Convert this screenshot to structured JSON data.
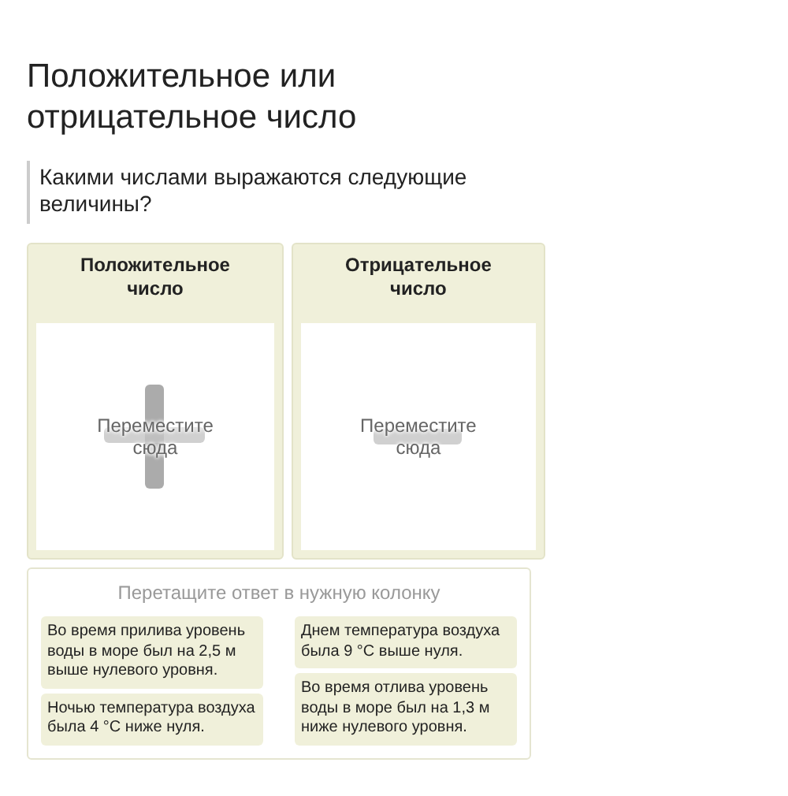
{
  "title": "Положительное или отрицательное число",
  "question": "Какими числами выражаются следующие величины?",
  "columns": [
    {
      "heading": "Положительное число",
      "placeholder": "Переместите сюда",
      "kind": "plus"
    },
    {
      "heading": "Отрицательное число",
      "placeholder": "Переместите сюда",
      "kind": "minus"
    }
  ],
  "answers": {
    "hint": "Перетащите ответ в нужную колонку",
    "columns": [
      [
        "Во время прилива уровень воды в море был на 2,5 м выше нулевого уровня.",
        "Ночью температура воздуха была 4 °С ниже нуля."
      ],
      [
        "Днем температура воздуха была 9 °С выше нуля.",
        "Во время отлива уровень воды в море был на 1,3 м ниже нулевого уровня."
      ]
    ]
  }
}
